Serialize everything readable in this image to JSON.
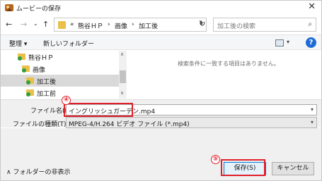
{
  "window": {
    "title": "ムービーの保存",
    "close_icon": "✕"
  },
  "nav": {
    "back_icon": "←",
    "forward_icon": "→",
    "recent_icon": "⌄",
    "up_icon": "↑",
    "crumb_prefix": "«",
    "breadcrumbs": [
      "熊谷ＨＰ",
      "画像",
      "加工後"
    ],
    "separator": "›",
    "refresh_icon": "↻",
    "search_placeholder": "加工後の検索",
    "search_icon": "⌕"
  },
  "toolbar": {
    "organize": "整理 ▾",
    "new_folder": "新しいフォルダー",
    "help": "?"
  },
  "tree": {
    "items": [
      {
        "label": "熊谷ＨＰ"
      },
      {
        "label": "画像"
      },
      {
        "label": "加工後"
      },
      {
        "label": "加工前"
      }
    ]
  },
  "content": {
    "empty_message": "検索条件に一致する項目はありません。"
  },
  "form": {
    "filename_label": "ファイル名(N):",
    "filename_value": "イングリッシュガーデン.mp4",
    "filetype_label": "ファイルの種類(T):",
    "filetype_value": "MPEG-4/H.264 ビデオ ファイル (*.mp4)"
  },
  "footer": {
    "hide_folders": "フォルダーの非表示",
    "save": "保存(S)",
    "cancel": "キャンセル"
  },
  "annotations": {
    "step4": "④",
    "step5": "⑤"
  },
  "colors": {
    "annotation": "#e0202a",
    "accent": "#0078d7",
    "folder": "#e8c04a"
  }
}
